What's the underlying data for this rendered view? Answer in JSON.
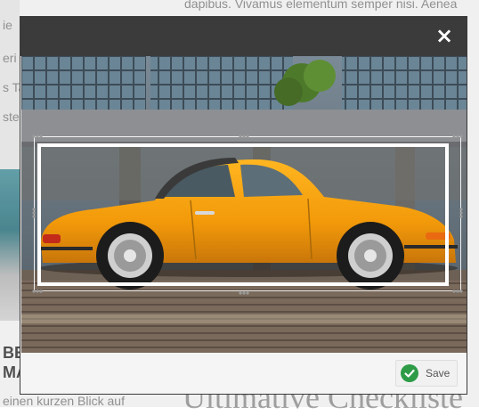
{
  "background": {
    "top_text": "dapibus. Vivamus elementum semper nisi. Aenea",
    "left_fragments": [
      "ie",
      "eri",
      "s Ta",
      "ste"
    ],
    "heading_letters": [
      "BE",
      "MA"
    ],
    "bottom_left_text": "einen kurzen Blick auf",
    "big_heading": "Ultimative Checkliste"
  },
  "modal": {
    "close_glyph": "×",
    "icon": "close-icon"
  },
  "footer": {
    "save_label": "Save",
    "save_icon": "check-circle-icon",
    "accent": "#2e9b47"
  }
}
